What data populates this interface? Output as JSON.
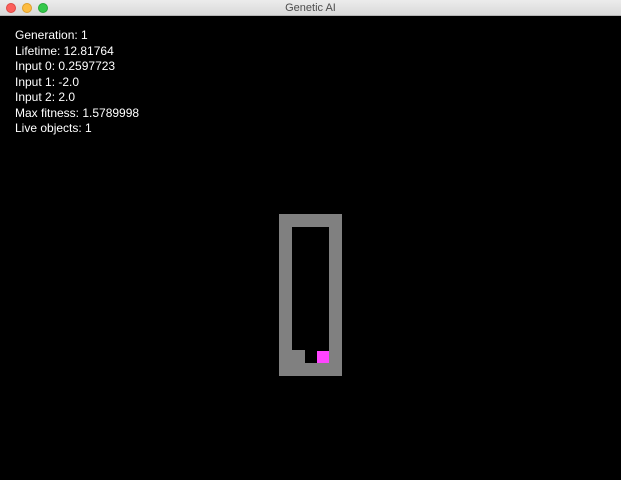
{
  "window": {
    "title": "Genetic AI"
  },
  "hud": {
    "generation": "Generation: 1",
    "lifetime": "Lifetime: 12.81764",
    "input0": "Input 0: 0.2597723",
    "input1": "Input 1: -2.0",
    "input2": "Input 2: 2.0",
    "max_fitness": "Max fitness: 1.5789998",
    "live_objects": "Live objects: 1"
  },
  "colors": {
    "background": "#000000",
    "wall": "#808080",
    "agent": "#ff44ff",
    "text": "#ffffff"
  }
}
